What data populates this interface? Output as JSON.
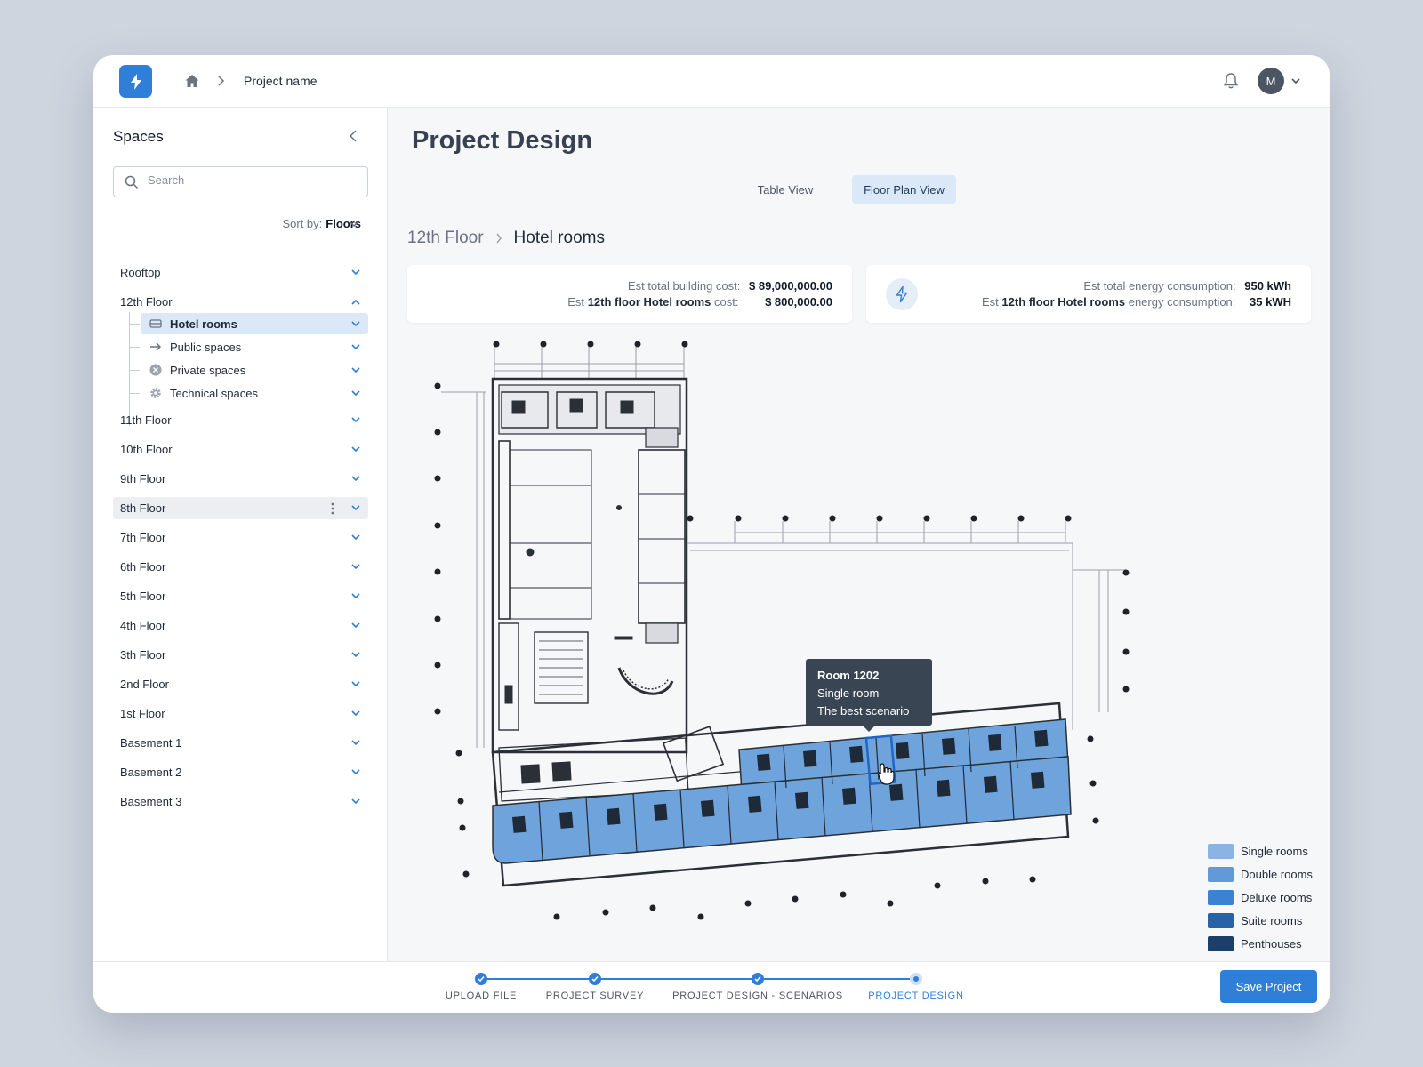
{
  "topbar": {
    "breadcrumb_project": "Project name",
    "avatar_initial": "M"
  },
  "sidebar": {
    "title": "Spaces",
    "search_placeholder": "Search",
    "sort_label": "Sort by:",
    "sort_value": "Floors",
    "floors": [
      {
        "label": "Rooftop"
      },
      {
        "label": "12th Floor",
        "expanded": true
      },
      {
        "label": "11th Floor"
      },
      {
        "label": "10th Floor"
      },
      {
        "label": "9th Floor"
      },
      {
        "label": "8th Floor"
      },
      {
        "label": "7th Floor"
      },
      {
        "label": "6th Floor"
      },
      {
        "label": "5th Floor"
      },
      {
        "label": "4th Floor"
      },
      {
        "label": "3th Floor"
      },
      {
        "label": "2nd Floor"
      },
      {
        "label": "1st Floor"
      },
      {
        "label": "Basement 1"
      },
      {
        "label": "Basement 2"
      },
      {
        "label": "Basement 3"
      }
    ],
    "children": [
      {
        "label": "Hotel rooms",
        "icon": "bed-icon",
        "active": true
      },
      {
        "label": "Public spaces",
        "icon": "arrow-right-icon"
      },
      {
        "label": "Private spaces",
        "icon": "x-circle-icon"
      },
      {
        "label": "Technical spaces",
        "icon": "gear-icon"
      }
    ]
  },
  "main": {
    "title": "Project Design",
    "tabs": [
      {
        "label": "Table View"
      },
      {
        "label": "Floor Plan View",
        "active": true
      }
    ],
    "breadcrumb": {
      "floor": "12th Floor",
      "space": "Hotel rooms"
    },
    "cost_card": {
      "line1_label": "Est total building cost:",
      "line1_value": "$ 89,000,000.00",
      "line2_prefix": "Est",
      "line2_bold": "12th floor Hotel rooms",
      "line2_suffix": "cost:",
      "line2_value": "$ 800,000.00"
    },
    "energy_card": {
      "line1_label": "Est total energy consumption:",
      "line1_value": "950 kWh",
      "line2_prefix": "Est",
      "line2_bold": "12th floor Hotel rooms",
      "line2_suffix": "energy consumption:",
      "line2_value": "35 kWH"
    },
    "tooltip": {
      "room": "Room 1202",
      "type": "Single room",
      "scenario": "The best scenario"
    },
    "legend": [
      {
        "label": "Single rooms",
        "color": "#8ab4e3"
      },
      {
        "label": "Double rooms",
        "color": "#5f9ad9"
      },
      {
        "label": "Deluxe rooms",
        "color": "#3b82d1"
      },
      {
        "label": "Suite rooms",
        "color": "#2863a6"
      },
      {
        "label": "Penthouses",
        "color": "#1b3f69"
      }
    ]
  },
  "footer": {
    "steps": [
      {
        "label": "UPLOAD FILE",
        "done": true
      },
      {
        "label": "PROJECT SURVEY",
        "done": true
      },
      {
        "label": "PROJECT DESIGN - SCENARIOS",
        "done": true
      },
      {
        "label": "PROJECT DESIGN",
        "current": true
      }
    ],
    "save_label": "Save Project"
  },
  "colors": {
    "accent": "#2f7fd9",
    "room_fill": "#6fa3dc",
    "active_bg": "#dbe8f7"
  }
}
